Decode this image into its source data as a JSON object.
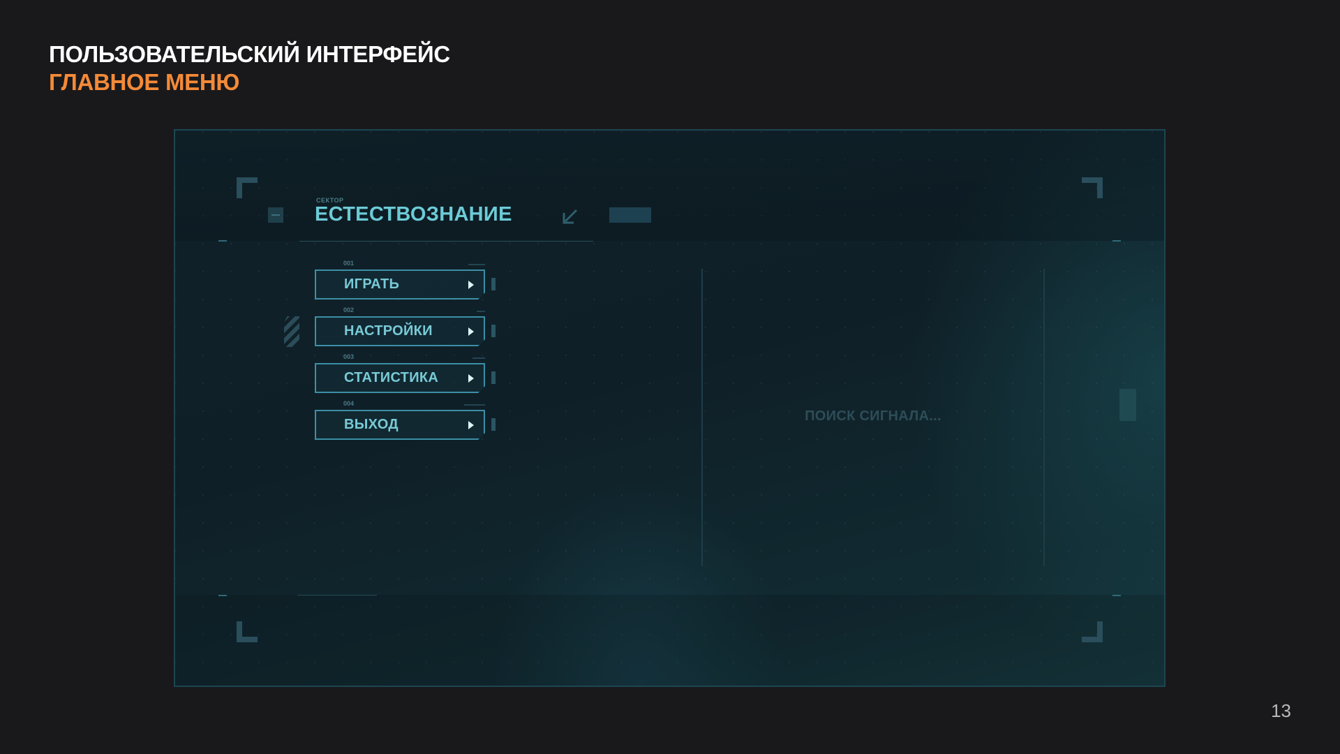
{
  "slide": {
    "title_line1": "ПОЛЬЗОВАТЕЛЬСКИЙ ИНТЕРФЕЙС",
    "title_line2": "ГЛАВНОЕ МЕНЮ",
    "page_number": "13",
    "accent_color": "#f48a38"
  },
  "ui": {
    "sector_label": "СЕКТОР",
    "sector_title": "ЕСТЕСТВОЗНАНИЕ",
    "header_icons": [
      "minus-icon",
      "collapse-arrow-icon"
    ],
    "menu": [
      {
        "index": "001",
        "label": "ИГРАТЬ",
        "icon": "play-arrow-icon"
      },
      {
        "index": "002",
        "label": "НАСТРОЙКИ",
        "icon": "play-arrow-icon"
      },
      {
        "index": "003",
        "label": "СТАТИСТИКА",
        "icon": "play-arrow-icon"
      },
      {
        "index": "004",
        "label": "ВЫХОД",
        "icon": "play-arrow-icon"
      }
    ],
    "status_text": "ПОИСК СИГНАЛА...",
    "colors": {
      "primary_text": "#6ccbd6",
      "button_border": "#3c8fa6",
      "background": "#102129"
    }
  }
}
